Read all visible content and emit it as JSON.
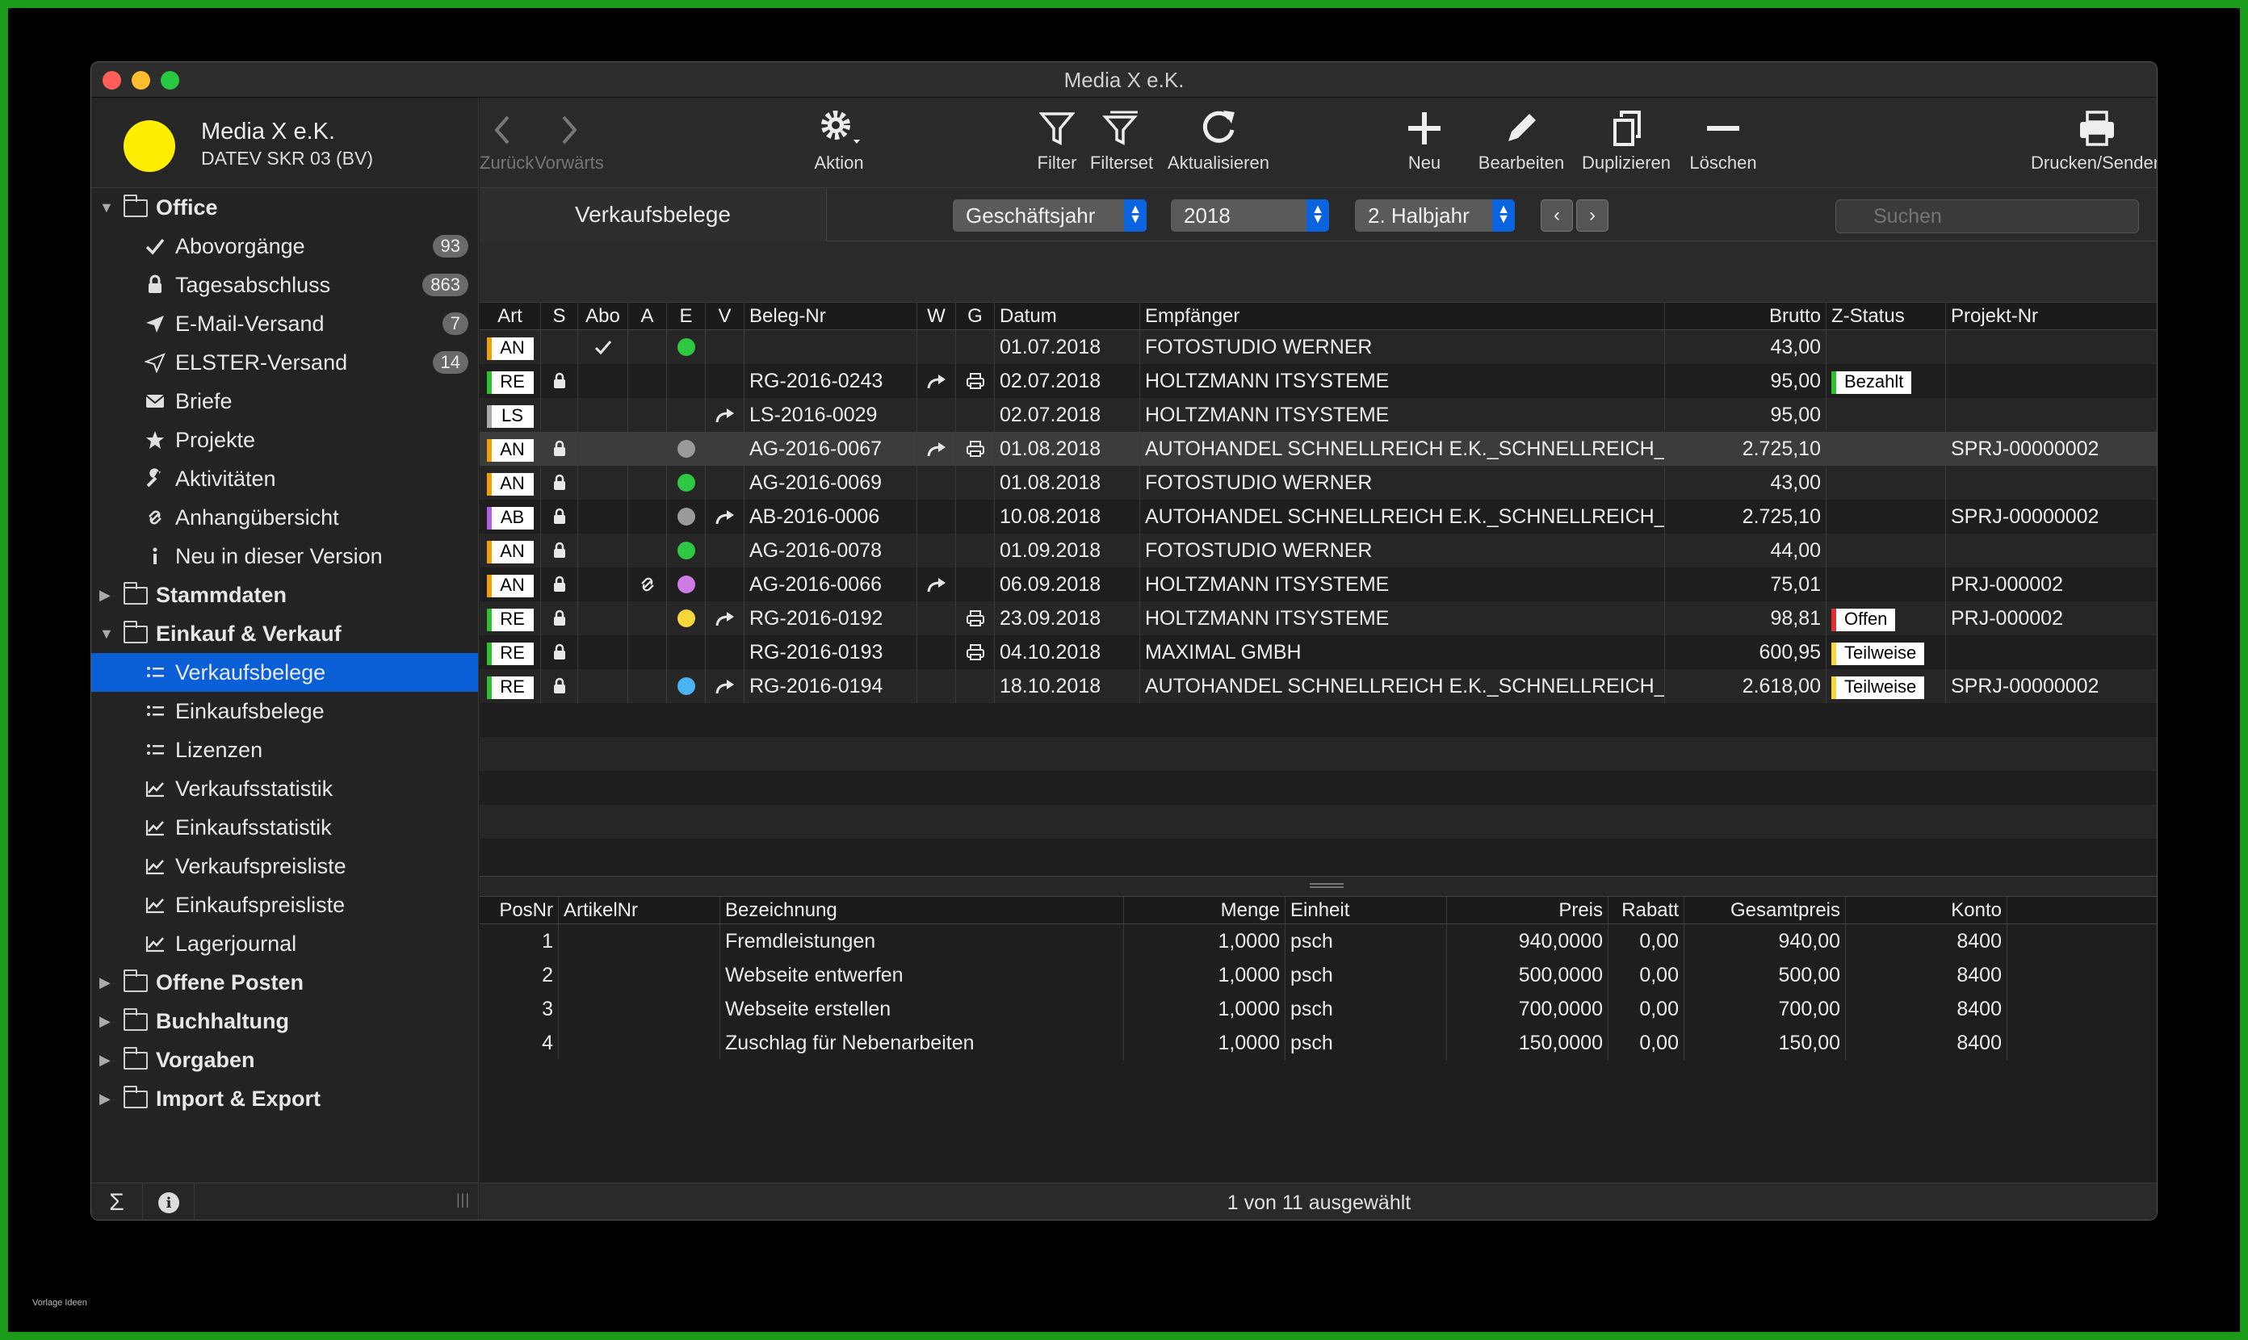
{
  "window": {
    "title": "Media X e.K."
  },
  "account": {
    "name": "Media X e.K.",
    "subtitle": "DATEV SKR 03 (BV)",
    "avatar_color": "#ffee00"
  },
  "sidebar": {
    "groups": [
      {
        "label": "Office",
        "expanded": true,
        "items": [
          {
            "label": "Abovorgänge",
            "icon": "checkmark-icon",
            "badge": "93"
          },
          {
            "label": "Tagesabschluss",
            "icon": "lock-icon",
            "badge": "863"
          },
          {
            "label": "E-Mail-Versand",
            "icon": "send-icon",
            "badge": "7"
          },
          {
            "label": "ELSTER-Versand",
            "icon": "send-outline-icon",
            "badge": "14"
          },
          {
            "label": "Briefe",
            "icon": "envelope-icon",
            "badge": ""
          },
          {
            "label": "Projekte",
            "icon": "star-icon",
            "badge": ""
          },
          {
            "label": "Aktivitäten",
            "icon": "wrench-icon",
            "badge": ""
          },
          {
            "label": "Anhangübersicht",
            "icon": "paperclip-icon",
            "badge": ""
          },
          {
            "label": "Neu in dieser Version",
            "icon": "info-icon",
            "badge": ""
          }
        ]
      },
      {
        "label": "Stammdaten",
        "expanded": false,
        "items": []
      },
      {
        "label": "Einkauf & Verkauf",
        "expanded": true,
        "items": [
          {
            "label": "Verkaufsbelege",
            "icon": "list-icon",
            "badge": "",
            "selected": true
          },
          {
            "label": "Einkaufsbelege",
            "icon": "list-icon",
            "badge": ""
          },
          {
            "label": "Lizenzen",
            "icon": "list-icon",
            "badge": ""
          },
          {
            "label": "Verkaufsstatistik",
            "icon": "chart-line-icon",
            "badge": ""
          },
          {
            "label": "Einkaufsstatistik",
            "icon": "chart-line-icon",
            "badge": ""
          },
          {
            "label": "Verkaufspreisliste",
            "icon": "chart-line-icon",
            "badge": ""
          },
          {
            "label": "Einkaufspreisliste",
            "icon": "chart-line-icon",
            "badge": ""
          },
          {
            "label": "Lagerjournal",
            "icon": "chart-line-icon",
            "badge": ""
          }
        ]
      },
      {
        "label": "Offene Posten",
        "expanded": false,
        "items": []
      },
      {
        "label": "Buchhaltung",
        "expanded": false,
        "items": []
      },
      {
        "label": "Vorgaben",
        "expanded": false,
        "items": []
      },
      {
        "label": "Import & Export",
        "expanded": false,
        "items": []
      }
    ],
    "footer": {
      "sum_symbol": "Σ",
      "info_symbol": "i",
      "grip": "|||"
    }
  },
  "toolbar": {
    "back": "Zurück",
    "forward": "Vorwärts",
    "action": "Aktion",
    "filter": "Filter",
    "filterset": "Filterset",
    "refresh": "Aktualisieren",
    "new": "Neu",
    "edit": "Bearbeiten",
    "duplicate": "Duplizieren",
    "delete": "Löschen",
    "print": "Drucken/Senden"
  },
  "filterbar": {
    "tab_title": "Verkaufsbelege",
    "period_type": "Geschäftsjahr",
    "year": "2018",
    "range": "2. Halbjahr",
    "search_placeholder": "Suchen"
  },
  "documents": {
    "columns": [
      "Art",
      "S",
      "Abo",
      "A",
      "E",
      "V",
      "Beleg-Nr",
      "W",
      "G",
      "Datum",
      "Empfänger",
      "Brutto",
      "Z-Status",
      "Projekt-Nr"
    ],
    "type_colors": {
      "AN": "#f0a000",
      "RE": "#2ec02e",
      "LS": "#aaaaaa",
      "AB": "#b060e0"
    },
    "dot_colors": {
      "green": "#2ec843",
      "gray": "#9a9a9a",
      "purple": "#d07ae8",
      "yellow": "#f5d73b",
      "blue": "#4ab4f0"
    },
    "status_colors": {
      "Bezahlt": "#2ec02e",
      "Offen": "#e03030",
      "Teilweise": "#f5d73b"
    },
    "rows": [
      {
        "art": "AN",
        "lock": false,
        "abo": true,
        "attach": false,
        "dot": "green",
        "fwd": false,
        "nr": "",
        "w": false,
        "g": false,
        "datum": "01.07.2018",
        "empf": "FOTOSTUDIO WERNER",
        "brutto": "43,00",
        "status": "",
        "projekt": ""
      },
      {
        "art": "RE",
        "lock": true,
        "abo": false,
        "attach": false,
        "dot": "",
        "fwd": false,
        "nr": "RG-2016-0243",
        "w": true,
        "g": true,
        "datum": "02.07.2018",
        "empf": "HOLTZMANN ITSYSTEME",
        "brutto": "95,00",
        "status": "Bezahlt",
        "projekt": ""
      },
      {
        "art": "LS",
        "lock": false,
        "abo": false,
        "attach": false,
        "dot": "",
        "fwd": true,
        "nr": "LS-2016-0029",
        "w": false,
        "g": false,
        "datum": "02.07.2018",
        "empf": "HOLTZMANN ITSYSTEME",
        "brutto": "95,00",
        "status": "",
        "projekt": ""
      },
      {
        "art": "AN",
        "lock": true,
        "abo": false,
        "attach": false,
        "dot": "gray",
        "fwd": false,
        "nr": "AG-2016-0067",
        "w": true,
        "g": true,
        "datum": "01.08.2018",
        "empf": "AUTOHANDEL SCHNELLREICH E.K._SCHNELLREICH_...",
        "brutto": "2.725,10",
        "status": "",
        "projekt": "SPRJ-00000002",
        "selected": true
      },
      {
        "art": "AN",
        "lock": true,
        "abo": false,
        "attach": false,
        "dot": "green",
        "fwd": false,
        "nr": "AG-2016-0069",
        "w": false,
        "g": false,
        "datum": "01.08.2018",
        "empf": "FOTOSTUDIO WERNER",
        "brutto": "43,00",
        "status": "",
        "projekt": ""
      },
      {
        "art": "AB",
        "lock": true,
        "abo": false,
        "attach": false,
        "dot": "gray",
        "fwd": true,
        "nr": "AB-2016-0006",
        "w": false,
        "g": false,
        "datum": "10.08.2018",
        "empf": "AUTOHANDEL SCHNELLREICH E.K._SCHNELLREICH_...",
        "brutto": "2.725,10",
        "status": "",
        "projekt": "SPRJ-00000002"
      },
      {
        "art": "AN",
        "lock": true,
        "abo": false,
        "attach": false,
        "dot": "green",
        "fwd": false,
        "nr": "AG-2016-0078",
        "w": false,
        "g": false,
        "datum": "01.09.2018",
        "empf": "FOTOSTUDIO WERNER",
        "brutto": "44,00",
        "status": "",
        "projekt": ""
      },
      {
        "art": "AN",
        "lock": true,
        "abo": false,
        "attach": true,
        "dot": "purple",
        "fwd": false,
        "nr": "AG-2016-0066",
        "w": true,
        "g": false,
        "datum": "06.09.2018",
        "empf": "HOLTZMANN ITSYSTEME",
        "brutto": "75,01",
        "status": "",
        "projekt": "PRJ-000002"
      },
      {
        "art": "RE",
        "lock": true,
        "abo": false,
        "attach": false,
        "dot": "yellow",
        "fwd": true,
        "nr": "RG-2016-0192",
        "w": false,
        "g": true,
        "datum": "23.09.2018",
        "empf": "HOLTZMANN ITSYSTEME",
        "brutto": "98,81",
        "status": "Offen",
        "projekt": "PRJ-000002"
      },
      {
        "art": "RE",
        "lock": true,
        "abo": false,
        "attach": false,
        "dot": "",
        "fwd": false,
        "nr": "RG-2016-0193",
        "w": false,
        "g": true,
        "datum": "04.10.2018",
        "empf": "MAXIMAL GMBH",
        "brutto": "600,95",
        "status": "Teilweise",
        "projekt": ""
      },
      {
        "art": "RE",
        "lock": true,
        "abo": false,
        "attach": false,
        "dot": "blue",
        "fwd": true,
        "nr": "RG-2016-0194",
        "w": false,
        "g": false,
        "datum": "18.10.2018",
        "empf": "AUTOHANDEL SCHNELLREICH E.K._SCHNELLREICH_...",
        "brutto": "2.618,00",
        "status": "Teilweise",
        "projekt": "SPRJ-00000002"
      }
    ]
  },
  "positions": {
    "columns": [
      "PosNr",
      "ArtikelNr",
      "Bezeichnung",
      "Menge",
      "Einheit",
      "Preis",
      "Rabatt",
      "Gesamtpreis",
      "Konto"
    ],
    "rows": [
      {
        "pos": "1",
        "artikel": "",
        "bez": "Fremdleistungen",
        "menge": "1,0000",
        "einheit": "psch",
        "preis": "940,0000",
        "rabatt": "0,00",
        "gesamt": "940,00",
        "konto": "8400"
      },
      {
        "pos": "2",
        "artikel": "",
        "bez": "Webseite entwerfen",
        "menge": "1,0000",
        "einheit": "psch",
        "preis": "500,0000",
        "rabatt": "0,00",
        "gesamt": "500,00",
        "konto": "8400"
      },
      {
        "pos": "3",
        "artikel": "",
        "bez": "Webseite erstellen",
        "menge": "1,0000",
        "einheit": "psch",
        "preis": "700,0000",
        "rabatt": "0,00",
        "gesamt": "700,00",
        "konto": "8400"
      },
      {
        "pos": "4",
        "artikel": "",
        "bez": "Zuschlag für Nebenarbeiten",
        "menge": "1,0000",
        "einheit": "psch",
        "preis": "150,0000",
        "rabatt": "0,00",
        "gesamt": "150,00",
        "konto": "8400"
      }
    ]
  },
  "status": {
    "text": "1 von 11 ausgewählt"
  },
  "watermark": "Vorlage Ideen"
}
